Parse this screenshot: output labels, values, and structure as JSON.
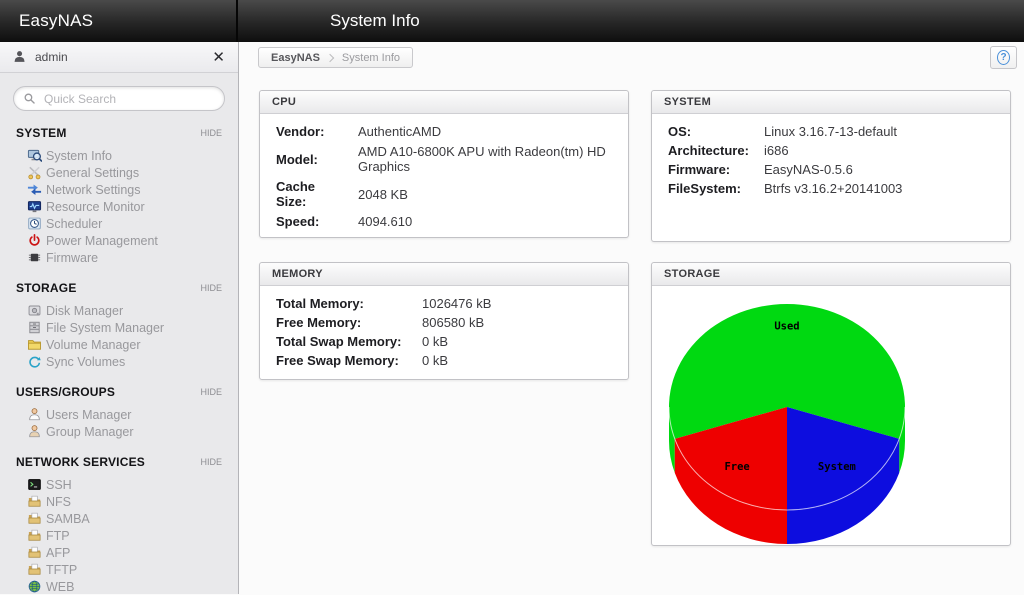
{
  "header": {
    "app_title": "EasyNAS",
    "page_title": "System Info"
  },
  "sidebar": {
    "user": {
      "name": "admin"
    },
    "search": {
      "placeholder": "Quick Search"
    },
    "sections": [
      {
        "title": "SYSTEM",
        "hide_label": "HIDE",
        "items": [
          {
            "label": "System Info",
            "icon": "system-info-icon"
          },
          {
            "label": "General Settings",
            "icon": "general-settings-icon"
          },
          {
            "label": "Network Settings",
            "icon": "network-settings-icon"
          },
          {
            "label": "Resource Monitor",
            "icon": "resource-monitor-icon"
          },
          {
            "label": "Scheduler",
            "icon": "scheduler-icon"
          },
          {
            "label": "Power Management",
            "icon": "power-management-icon"
          },
          {
            "label": "Firmware",
            "icon": "firmware-icon"
          }
        ]
      },
      {
        "title": "STORAGE",
        "hide_label": "HIDE",
        "items": [
          {
            "label": "Disk Manager",
            "icon": "disk-manager-icon"
          },
          {
            "label": "File System Manager",
            "icon": "file-system-manager-icon"
          },
          {
            "label": "Volume Manager",
            "icon": "volume-manager-icon"
          },
          {
            "label": "Sync Volumes",
            "icon": "sync-volumes-icon"
          }
        ]
      },
      {
        "title": "USERS/GROUPS",
        "hide_label": "HIDE",
        "items": [
          {
            "label": "Users Manager",
            "icon": "users-manager-icon"
          },
          {
            "label": "Group Manager",
            "icon": "group-manager-icon"
          }
        ]
      },
      {
        "title": "NETWORK SERVICES",
        "hide_label": "HIDE",
        "items": [
          {
            "label": "SSH",
            "icon": "ssh-icon"
          },
          {
            "label": "NFS",
            "icon": "nfs-icon"
          },
          {
            "label": "SAMBA",
            "icon": "samba-icon"
          },
          {
            "label": "FTP",
            "icon": "ftp-icon"
          },
          {
            "label": "AFP",
            "icon": "afp-icon"
          },
          {
            "label": "TFTP",
            "icon": "tftp-icon"
          },
          {
            "label": "WEB",
            "icon": "web-icon"
          }
        ]
      }
    ]
  },
  "breadcrumb": {
    "items": [
      "EasyNAS",
      "System Info"
    ]
  },
  "icons": {
    "close_glyph": "✕",
    "help_glyph": "?"
  },
  "panels": {
    "cpu": {
      "title": "CPU",
      "rows": [
        [
          "Vendor:",
          "AuthenticAMD"
        ],
        [
          "Model:",
          "AMD A10-6800K APU with Radeon(tm) HD Graphics"
        ],
        [
          "Cache Size:",
          "2048 KB"
        ],
        [
          "Speed:",
          "4094.610"
        ]
      ]
    },
    "system": {
      "title": "SYSTEM",
      "rows": [
        [
          "OS:",
          "Linux 3.16.7-13-default"
        ],
        [
          "Architecture:",
          "i686"
        ],
        [
          "Firmware:",
          "EasyNAS-0.5.6"
        ],
        [
          "FileSystem:",
          "Btrfs v3.16.2+20141003"
        ]
      ]
    },
    "memory": {
      "title": "MEMORY",
      "rows": [
        [
          "Total Memory:",
          "1026476 kB"
        ],
        [
          "Free Memory:",
          "806580 kB"
        ],
        [
          "Total Swap Memory:",
          "0 kB"
        ],
        [
          "Free Swap Memory:",
          "0 kB"
        ]
      ]
    },
    "storage": {
      "title": "STORAGE"
    }
  },
  "chart_data": {
    "type": "pie",
    "title": "",
    "style": "3d",
    "legend_position": "none",
    "start_angle_deg": 342,
    "label_color": "#000000",
    "slices": [
      {
        "label": "Used",
        "value": 60,
        "color": "#00d911"
      },
      {
        "label": "Free",
        "value": 20,
        "color": "#ee0000"
      },
      {
        "label": "System",
        "value": 20,
        "color": "#0d0ddf"
      }
    ]
  }
}
